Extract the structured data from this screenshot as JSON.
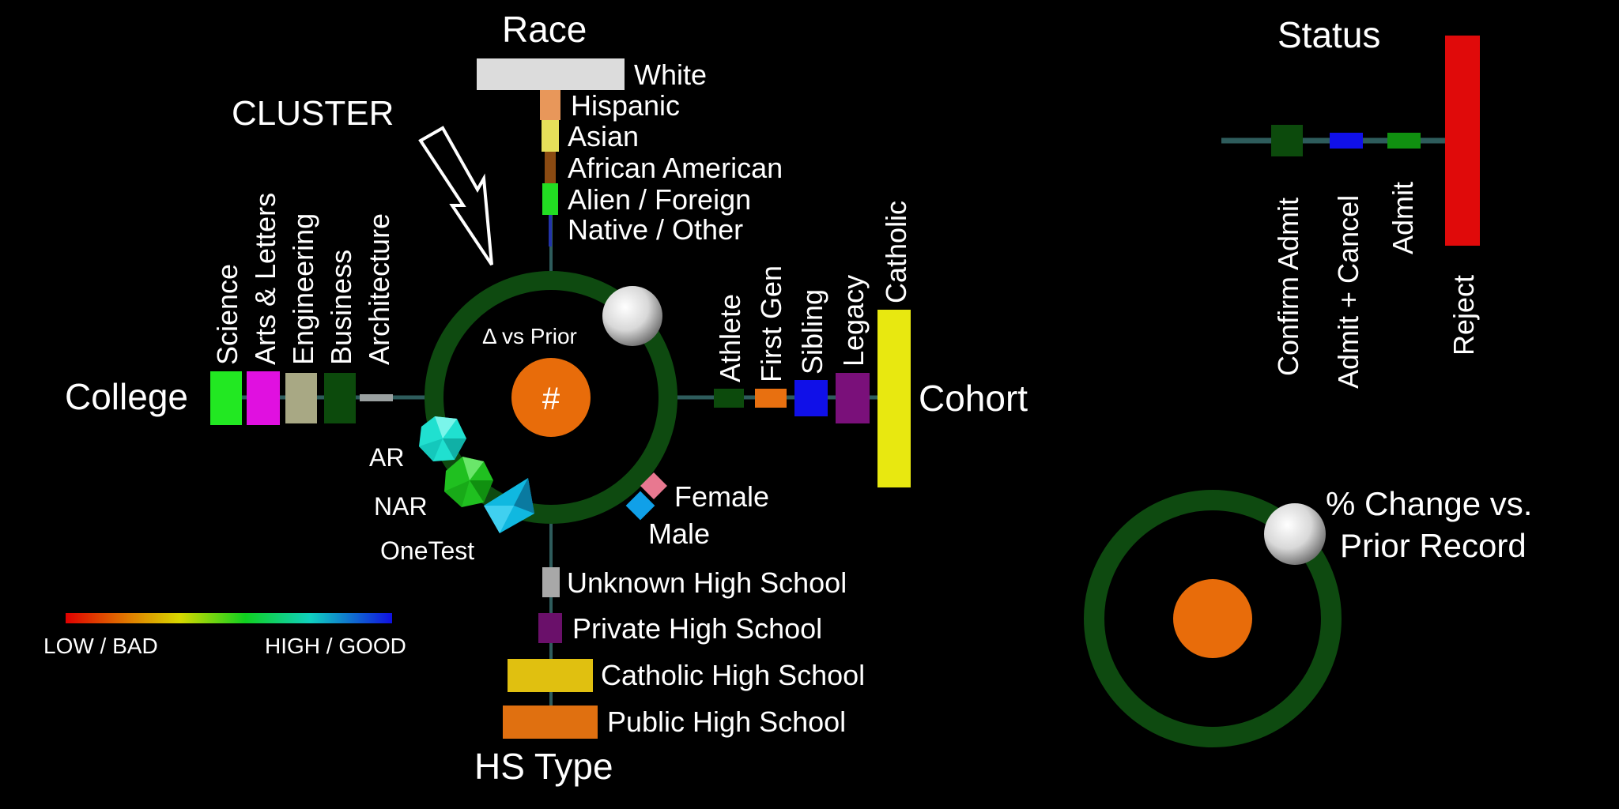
{
  "race": {
    "title": "Race",
    "items": [
      {
        "label": "White",
        "color": "#dcdcdc"
      },
      {
        "label": "Hispanic",
        "color": "#e8975a"
      },
      {
        "label": "Asian",
        "color": "#e6e05a"
      },
      {
        "label": "African American",
        "color": "#8a4a12"
      },
      {
        "label": "Alien / Foreign",
        "color": "#22dd22"
      },
      {
        "label": "Native / Other",
        "color": "#2233aa"
      }
    ]
  },
  "cluster_label": "CLUSTER",
  "college": {
    "title": "College",
    "items": [
      {
        "label": "Science",
        "color": "#22e822"
      },
      {
        "label": "Arts & Letters",
        "color": "#e010e0"
      },
      {
        "label": "Engineering",
        "color": "#a8a884"
      },
      {
        "label": "Business",
        "color": "#0c4a0c"
      },
      {
        "label": "Architecture",
        "color": "#9aa0a0"
      }
    ]
  },
  "cohort": {
    "title": "Cohort",
    "items": [
      {
        "label": "Athlete",
        "color": "#0c4a0c"
      },
      {
        "label": "First Gen",
        "color": "#e87010"
      },
      {
        "label": "Sibling",
        "color": "#1010e8"
      },
      {
        "label": "Legacy",
        "color": "#7a107a"
      },
      {
        "label": "Catholic",
        "color": "#e8e810"
      }
    ]
  },
  "hs_type": {
    "title": "HS Type",
    "items": [
      {
        "label": "Unknown High School",
        "color": "#a8a8a8"
      },
      {
        "label": "Private High School",
        "color": "#6a106a"
      },
      {
        "label": "Catholic High School",
        "color": "#e0c010"
      },
      {
        "label": "Public High School",
        "color": "#e07010"
      }
    ]
  },
  "gender": {
    "female": {
      "label": "Female",
      "color": "#e87890"
    },
    "male": {
      "label": "Male",
      "color": "#10a0e8"
    }
  },
  "tests": {
    "ar": {
      "label": "AR",
      "color": "#20e0d0"
    },
    "nar": {
      "label": "NAR",
      "color": "#20c020"
    },
    "onetest": {
      "label": "OneTest",
      "color": "#10b8e0"
    }
  },
  "center": {
    "delta_label": "Δ vs Prior",
    "hash_label": "#",
    "ring_color": "#0e4a10",
    "center_color": "#e86c0a"
  },
  "status": {
    "title": "Status",
    "items": [
      {
        "label": "Confirm Admit",
        "color": "#0c4a0c"
      },
      {
        "label": "Admit + Cancel",
        "color": "#1010e8"
      },
      {
        "label": "Admit",
        "color": "#109010"
      },
      {
        "label": "Reject",
        "color": "#e00a0a"
      }
    ]
  },
  "legend": {
    "low": "LOW / BAD",
    "high": "HIGH / GOOD"
  },
  "key": {
    "line1": "% Change vs.",
    "line2": "Prior Record"
  }
}
